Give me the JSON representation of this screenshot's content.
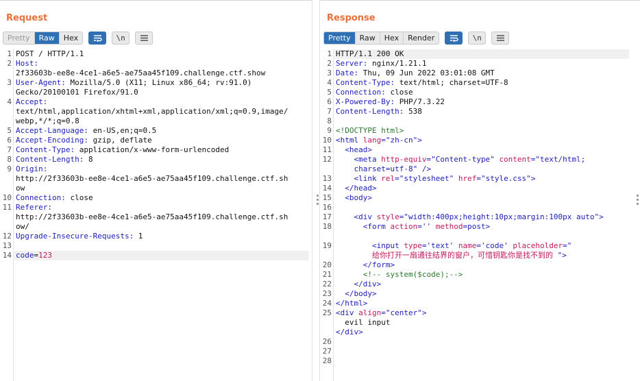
{
  "request": {
    "title": "Request",
    "view_tabs": [
      "Pretty",
      "Raw",
      "Hex"
    ],
    "active_tab": "Raw",
    "newline_label": "\\n",
    "lines": [
      [
        {
          "t": "POST / HTTP/1.1"
        }
      ],
      [
        {
          "t": "Host:",
          "c": "k"
        }
      ],
      [
        {
          "t": "2f33603b-ee8e-4ce1-a6e5-ae75aa45f109.challenge.ctf.show"
        }
      ],
      [
        {
          "t": "User-Agent:",
          "c": "k"
        },
        {
          "t": " Mozilla/5.0 (X11; Linux x86_64; rv:91.0)"
        }
      ],
      [
        {
          "t": "Gecko/20100101 Firefox/91.0"
        }
      ],
      [
        {
          "t": "Accept:",
          "c": "k"
        }
      ],
      [
        {
          "t": "text/html,application/xhtml+xml,application/xml;q=0.9,image/"
        }
      ],
      [
        {
          "t": "webp,*/*;q=0.8"
        }
      ],
      [
        {
          "t": "Accept-Language:",
          "c": "k"
        },
        {
          "t": " en-US,en;q=0.5"
        }
      ],
      [
        {
          "t": "Accept-Encoding:",
          "c": "k"
        },
        {
          "t": " gzip, deflate"
        }
      ],
      [
        {
          "t": "Content-Type:",
          "c": "k"
        },
        {
          "t": " application/x-www-form-urlencoded"
        }
      ],
      [
        {
          "t": "Content-Length:",
          "c": "k"
        },
        {
          "t": " 8"
        }
      ],
      [
        {
          "t": "Origin:",
          "c": "k"
        }
      ],
      [
        {
          "t": "http://2f33603b-ee8e-4ce1-a6e5-ae75aa45f109.challenge.ctf.sh"
        }
      ],
      [
        {
          "t": "ow"
        }
      ],
      [
        {
          "t": "Connection:",
          "c": "k"
        },
        {
          "t": " close"
        }
      ],
      [
        {
          "t": "Referer:",
          "c": "k"
        }
      ],
      [
        {
          "t": "http://2f33603b-ee8e-4ce1-a6e5-ae75aa45f109.challenge.ctf.sh"
        }
      ],
      [
        {
          "t": "ow/"
        }
      ],
      [
        {
          "t": "Upgrade-Insecure-Requests:",
          "c": "k"
        },
        {
          "t": " 1"
        }
      ],
      [],
      [
        {
          "t": "code",
          "c": "k"
        },
        {
          "t": "="
        },
        {
          "t": "123",
          "c": "red"
        }
      ]
    ],
    "line_numbers": [
      {
        "n": "1",
        "row": 0
      },
      {
        "n": "2",
        "row": 1
      },
      {
        "n": "3",
        "row": 3
      },
      {
        "n": "4",
        "row": 5
      },
      {
        "n": "5",
        "row": 8
      },
      {
        "n": "6",
        "row": 9
      },
      {
        "n": "7",
        "row": 10
      },
      {
        "n": "8",
        "row": 11
      },
      {
        "n": "9",
        "row": 12
      },
      {
        "n": "10",
        "row": 15
      },
      {
        "n": "11",
        "row": 16
      },
      {
        "n": "12",
        "row": 19
      },
      {
        "n": "13",
        "row": 20
      },
      {
        "n": "14",
        "row": 21
      }
    ]
  },
  "response": {
    "title": "Response",
    "view_tabs": [
      "Pretty",
      "Raw",
      "Hex",
      "Render"
    ],
    "active_tab": "Pretty",
    "newline_label": "\\n",
    "lines": [
      [
        {
          "t": "HTTP/1.1 200 OK"
        }
      ],
      [
        {
          "t": "Server:",
          "c": "k"
        },
        {
          "t": " nginx/1.21.1"
        }
      ],
      [
        {
          "t": "Date:",
          "c": "k"
        },
        {
          "t": " Thu, 09 Jun 2022 03:01:08 GMT"
        }
      ],
      [
        {
          "t": "Content-Type:",
          "c": "k"
        },
        {
          "t": " text/html; charset=UTF-8"
        }
      ],
      [
        {
          "t": "Connection:",
          "c": "k"
        },
        {
          "t": " close"
        }
      ],
      [
        {
          "t": "X-Powered-By:",
          "c": "k"
        },
        {
          "t": " PHP/7.3.22"
        }
      ],
      [
        {
          "t": "Content-Length:",
          "c": "k"
        },
        {
          "t": " 538"
        }
      ],
      [],
      [
        {
          "t": "<!DOCTYPE html>",
          "c": "cmt"
        }
      ],
      [
        {
          "t": "<html ",
          "c": "tag"
        },
        {
          "t": "lang",
          "c": "attr"
        },
        {
          "t": "=\"zh-cn\"",
          "c": "str"
        },
        {
          "t": ">",
          "c": "tag"
        }
      ],
      [
        {
          "t": "  <head>",
          "c": "tag"
        }
      ],
      [
        {
          "t": "    <meta ",
          "c": "tag"
        },
        {
          "t": "http-equiv",
          "c": "attr"
        },
        {
          "t": "=\"Content-type\" ",
          "c": "str"
        },
        {
          "t": "content",
          "c": "attr"
        },
        {
          "t": "=\"text/html;",
          "c": "str"
        }
      ],
      [
        {
          "t": "    charset=utf-8\" ",
          "c": "str"
        },
        {
          "t": "/>",
          "c": "tag"
        }
      ],
      [
        {
          "t": "    <link ",
          "c": "tag"
        },
        {
          "t": "rel",
          "c": "attr"
        },
        {
          "t": "=\"stylesheet\" ",
          "c": "str"
        },
        {
          "t": "href",
          "c": "attr"
        },
        {
          "t": "=\"style.css\"",
          "c": "str"
        },
        {
          "t": ">",
          "c": "tag"
        }
      ],
      [
        {
          "t": "  </head>",
          "c": "tag"
        }
      ],
      [
        {
          "t": "  <body>",
          "c": "tag"
        }
      ],
      [],
      [
        {
          "t": "    <div ",
          "c": "tag"
        },
        {
          "t": "style",
          "c": "attr"
        },
        {
          "t": "=\"width:400px;height:10px;margin:100px auto\"",
          "c": "str"
        },
        {
          "t": ">",
          "c": "tag"
        }
      ],
      [
        {
          "t": "      <form ",
          "c": "tag"
        },
        {
          "t": "action",
          "c": "attr"
        },
        {
          "t": "='' ",
          "c": "str"
        },
        {
          "t": "method",
          "c": "attr"
        },
        {
          "t": "=post",
          "c": "str"
        },
        {
          "t": ">",
          "c": "tag"
        }
      ],
      [],
      [
        {
          "t": "        <input ",
          "c": "tag"
        },
        {
          "t": "type",
          "c": "attr"
        },
        {
          "t": "='text' ",
          "c": "str"
        },
        {
          "t": "name",
          "c": "attr"
        },
        {
          "t": "='code' ",
          "c": "str"
        },
        {
          "t": "placeholder",
          "c": "attr"
        },
        {
          "t": "=\"",
          "c": "str"
        }
      ],
      [
        {
          "t": "        给你打开一扇通往结界的窗户，可惜钥匙你是找不到的 ",
          "c": "red"
        },
        {
          "t": "\">",
          "c": "tag"
        }
      ],
      [
        {
          "t": "      </form>",
          "c": "tag"
        }
      ],
      [
        {
          "t": "      <!-- system($code);-->",
          "c": "cmt"
        }
      ],
      [
        {
          "t": "    </div>",
          "c": "tag"
        }
      ],
      [
        {
          "t": "  </body>",
          "c": "tag"
        }
      ],
      [
        {
          "t": "</html>",
          "c": "tag"
        }
      ],
      [
        {
          "t": "<div ",
          "c": "tag"
        },
        {
          "t": "align",
          "c": "attr"
        },
        {
          "t": "=\"center\"",
          "c": "str"
        },
        {
          "t": ">",
          "c": "tag"
        }
      ],
      [
        {
          "t": "  evil input"
        }
      ],
      [
        {
          "t": "</div>",
          "c": "tag"
        }
      ],
      [],
      [],
      []
    ],
    "line_numbers": [
      {
        "n": "1",
        "row": 0
      },
      {
        "n": "2",
        "row": 1
      },
      {
        "n": "3",
        "row": 2
      },
      {
        "n": "4",
        "row": 3
      },
      {
        "n": "5",
        "row": 4
      },
      {
        "n": "6",
        "row": 5
      },
      {
        "n": "7",
        "row": 6
      },
      {
        "n": "8",
        "row": 7
      },
      {
        "n": "9",
        "row": 8
      },
      {
        "n": "10",
        "row": 9
      },
      {
        "n": "11",
        "row": 10
      },
      {
        "n": "12",
        "row": 11
      },
      {
        "n": "13",
        "row": 13
      },
      {
        "n": "14",
        "row": 14
      },
      {
        "n": "15",
        "row": 15
      },
      {
        "n": "16",
        "row": 16
      },
      {
        "n": "17",
        "row": 17
      },
      {
        "n": "18",
        "row": 18
      },
      {
        "n": "19",
        "row": 20
      },
      {
        "n": "20",
        "row": 22
      },
      {
        "n": "21",
        "row": 23
      },
      {
        "n": "22",
        "row": 24
      },
      {
        "n": "23",
        "row": 25
      },
      {
        "n": "24",
        "row": 26
      },
      {
        "n": "25",
        "row": 27
      },
      {
        "n": "26",
        "row": 30
      },
      {
        "n": "27",
        "row": 31
      },
      {
        "n": "28",
        "row": 32
      }
    ]
  }
}
